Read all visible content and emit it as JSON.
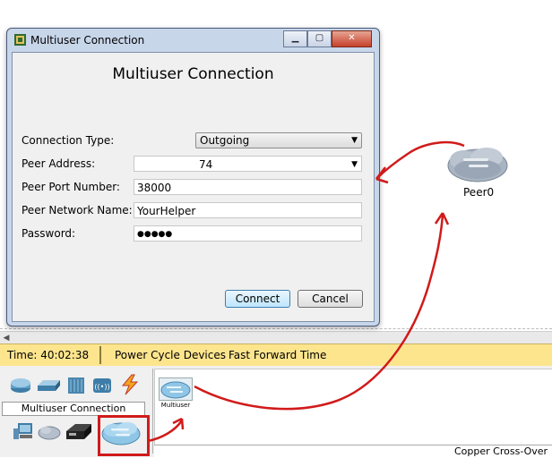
{
  "status_bar": {
    "time": "Time: 40:02:38",
    "power_cycle": "Power Cycle Devices",
    "fast_forward": "Fast Forward Time"
  },
  "dialog": {
    "window_title": "Multiuser Connection",
    "heading": "Multiuser Connection",
    "window_buttons": {
      "minimize": "▁",
      "maximize": "▢",
      "close": "✕"
    },
    "fields": {
      "connection_type": {
        "label": "Connection Type:",
        "value": "Outgoing"
      },
      "peer_address": {
        "label": "Peer Address:",
        "value": "74"
      },
      "peer_port": {
        "label": "Peer Port Number:",
        "value": "38000"
      },
      "peer_network_name": {
        "label": "Peer Network Name:",
        "value": "YourHelper"
      },
      "password": {
        "label": "Password:",
        "value": "●●●●●"
      }
    },
    "connect_label": "Connect",
    "cancel_label": "Cancel"
  },
  "workspace": {
    "peer_label": "Peer0"
  },
  "device_panel": {
    "category_label": "Multiuser Connection",
    "device_label": "Multiuser",
    "cable_label": "Copper Cross-Over"
  },
  "colors": {
    "status_bar": "#fde58e",
    "annotation_red": "#d11a1a",
    "primary_button": "#bee6fd"
  }
}
